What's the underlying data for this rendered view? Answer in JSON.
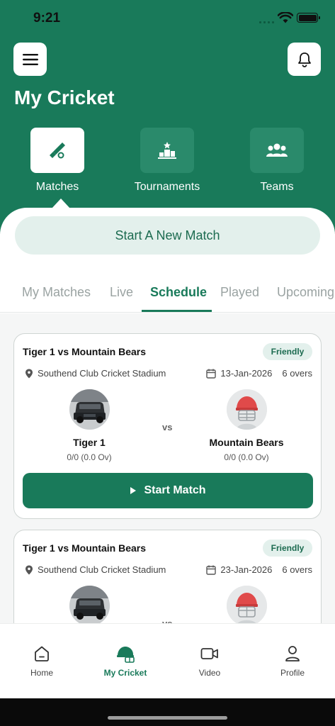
{
  "status_bar": {
    "time": "9:21"
  },
  "header": {
    "title": "My Cricket",
    "categories": [
      {
        "label": "Matches",
        "icon": "cricket-bat-icon",
        "active": true
      },
      {
        "label": "Tournaments",
        "icon": "podium-icon",
        "active": false
      },
      {
        "label": "Teams",
        "icon": "team-icon",
        "active": false
      }
    ]
  },
  "start_new_match_label": "Start A New Match",
  "tabs": [
    "My Matches",
    "Live",
    "Schedule",
    "Played",
    "Upcoming"
  ],
  "active_tab": "Schedule",
  "matches": [
    {
      "title": "Tiger 1 vs Mountain Bears",
      "badge": "Friendly",
      "venue": "Southend Club Cricket Stadium",
      "date": "13-Jan-2026",
      "overs": "6 overs",
      "team_a": {
        "name": "Tiger 1",
        "score": "0/0 (0.0 Ov)"
      },
      "vs": "vs",
      "team_b": {
        "name": "Mountain Bears",
        "score": "0/0 (0.0 Ov)"
      },
      "action_label": "Start Match"
    },
    {
      "title": "Tiger 1 vs Mountain Bears",
      "badge": "Friendly",
      "venue": "Southend Club Cricket Stadium",
      "date": "23-Jan-2026",
      "overs": "6 overs",
      "vs": "vs"
    }
  ],
  "bottom_nav": [
    {
      "label": "Home",
      "icon": "home-icon",
      "active": false
    },
    {
      "label": "My Cricket",
      "icon": "cricket-helmet-icon",
      "active": true
    },
    {
      "label": "Video",
      "icon": "video-icon",
      "active": false
    },
    {
      "label": "Profile",
      "icon": "profile-icon",
      "active": false
    }
  ],
  "colors": {
    "primary": "#197a5a",
    "tint": "#e3f0ec"
  }
}
